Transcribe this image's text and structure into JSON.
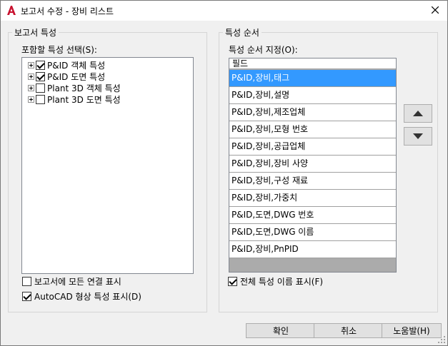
{
  "window": {
    "title": "보고서 수정 - 장비 리스트"
  },
  "report_props": {
    "group_label": "보고서 특성",
    "select_label": "포함할 특성 선택(S):",
    "tree": [
      {
        "label": "P&ID 객체 특성",
        "checked": true
      },
      {
        "label": "P&ID 도면 특성",
        "checked": true
      },
      {
        "label": "Plant 3D 객체 특성",
        "checked": false
      },
      {
        "label": "Plant 3D 도면 특성",
        "checked": false
      }
    ],
    "show_all_links": {
      "label": "보고서에 모든 연결 표시",
      "checked": false
    },
    "show_autocad": {
      "label": "AutoCAD 형상 특성 표시(D)",
      "checked": true
    }
  },
  "order": {
    "group_label": "특성 순서",
    "specify_label": "특성 순서 지정(O):",
    "column_header": "필드",
    "rows": [
      "P&ID,장비,태그",
      "P&ID,장비,설명",
      "P&ID,장비,제조업체",
      "P&ID,장비,모형 번호",
      "P&ID,장비,공급업체",
      "P&ID,장비,장비 사양",
      "P&ID,장비,구성 재료",
      "P&ID,장비,가중치",
      "P&ID,도면,DWG 번호",
      "P&ID,도면,DWG 이름",
      "P&ID,장비,PnPID"
    ],
    "selected_row": 0,
    "show_full_names": {
      "label": "전체 특성 이름 표시(F)",
      "checked": true
    }
  },
  "buttons": {
    "ok": "확인",
    "cancel": "취소",
    "help": "노움발(H)"
  },
  "colors": {
    "selection": "#3399ff",
    "app_icon": "#c8102e"
  }
}
